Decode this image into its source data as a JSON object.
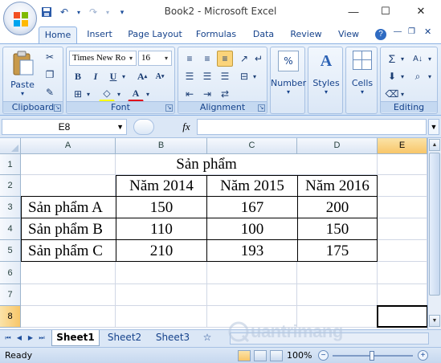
{
  "window": {
    "title": "Book2 - Microsoft Excel"
  },
  "qat": {
    "icons": [
      "save-icon",
      "undo-icon",
      "redo-icon",
      "customize-icon"
    ]
  },
  "tabs": [
    {
      "label": "Home",
      "active": true
    },
    {
      "label": "Insert"
    },
    {
      "label": "Page Layout"
    },
    {
      "label": "Formulas"
    },
    {
      "label": "Data"
    },
    {
      "label": "Review"
    },
    {
      "label": "View"
    }
  ],
  "ribbon": {
    "clipboard": {
      "label": "Clipboard",
      "paste_label": "Paste"
    },
    "font": {
      "label": "Font",
      "name": "Times New Ro",
      "size": "16"
    },
    "alignment": {
      "label": "Alignment"
    },
    "number": {
      "label": "Number"
    },
    "styles": {
      "label": "Styles"
    },
    "cells": {
      "label": "Cells"
    },
    "editing": {
      "label": "Editing"
    }
  },
  "formula_bar": {
    "name_box": "E8",
    "fx": "fx",
    "formula": ""
  },
  "columns": [
    "A",
    "B",
    "C",
    "D",
    "E"
  ],
  "selected_column": "E",
  "rows": [
    "1",
    "2",
    "3",
    "4",
    "5",
    "6",
    "7",
    "8"
  ],
  "selected_row": "8",
  "sheet": {
    "title": "Sản phẩm",
    "headers": [
      "Năm 2014",
      "Năm 2015",
      "Năm 2016"
    ],
    "data": [
      {
        "name": "Sản phẩm A",
        "values": [
          "150",
          "167",
          "200"
        ]
      },
      {
        "name": "Sản phẩm B",
        "values": [
          "110",
          "100",
          "150"
        ]
      },
      {
        "name": "Sản phẩm C",
        "values": [
          "210",
          "193",
          "175"
        ]
      }
    ]
  },
  "sheet_tabs": [
    {
      "label": "Sheet1",
      "active": true
    },
    {
      "label": "Sheet2"
    },
    {
      "label": "Sheet3"
    }
  ],
  "status": {
    "text": "Ready",
    "zoom": "100%",
    "zoom_level_percent": 100
  },
  "watermark": {
    "text": "uantrimang"
  },
  "colors": {
    "accent": "#15428b",
    "ribbon_bg": "#dbe7f6",
    "selection": "#f8c669",
    "table_border": "#000000"
  }
}
